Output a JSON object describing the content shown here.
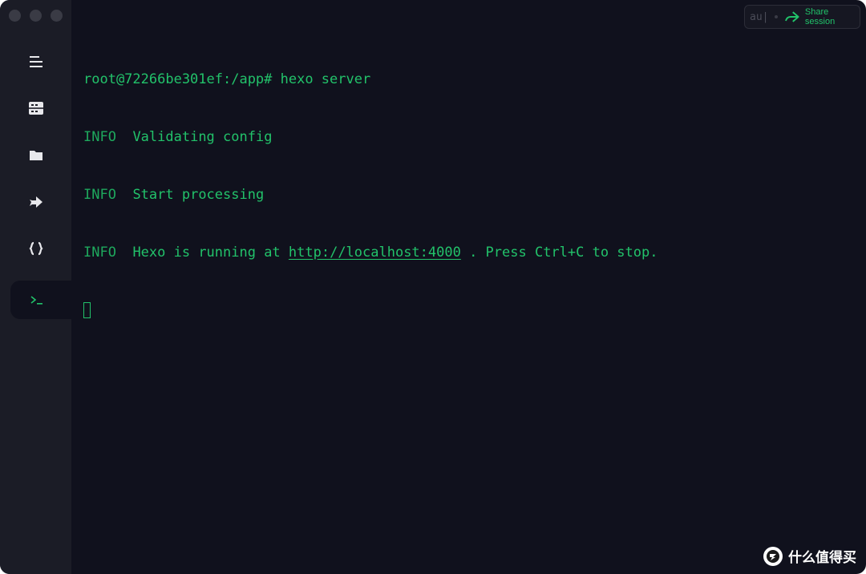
{
  "sidebar": {
    "items": [
      {
        "icon": "menu-icon"
      },
      {
        "icon": "server-icon"
      },
      {
        "icon": "folder-icon"
      },
      {
        "icon": "port-forward-icon"
      },
      {
        "icon": "code-braces-icon"
      },
      {
        "icon": "terminal-icon",
        "active": true
      }
    ]
  },
  "share": {
    "user_badge": "au|",
    "label": "Share session",
    "icon": "share-arrow-icon"
  },
  "terminal": {
    "lines": [
      {
        "text": "root@72266be301ef:/app# hexo server"
      },
      {
        "level": "INFO",
        "text": "Validating config"
      },
      {
        "level": "INFO",
        "text": "Start processing"
      },
      {
        "level": "INFO",
        "text_before": "Hexo is running at ",
        "link": "http://localhost:4000",
        "text_after": " . Press Ctrl+C to stop."
      }
    ]
  },
  "watermark": {
    "icon": "smzdm-logo-icon",
    "text": "什么值得买"
  },
  "colors": {
    "background": "#10111d",
    "sidebar": "#1b1c26",
    "terminal_text": "#22c26a",
    "accent": "#21c36a"
  }
}
